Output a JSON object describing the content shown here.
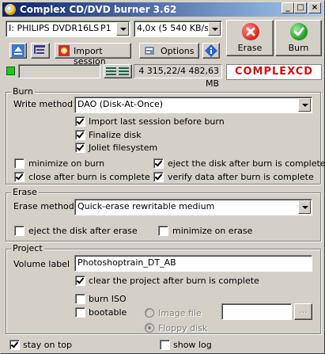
{
  "window": {
    "title": "Complex CD/DVD burner 3.62",
    "min": "_",
    "max": "□",
    "close": "×"
  },
  "toolbar": {
    "drive": "I: PHILIPS DVDR16LS",
    "drive_suffix": "P1",
    "speed": "4,0x (5 540 KB/s)",
    "import_session": "Import session",
    "options": "Options",
    "erase": "Erase",
    "burn": "Burn",
    "size": "4 315,22/4 482,63 MB",
    "logo": "COMPLEXCD"
  },
  "burn": {
    "title": "Burn",
    "write_method_label": "Write method",
    "write_method": "DAO (Disk-At-Once)",
    "import_last": "Import last session before burn",
    "finalize": "Finalize disk",
    "joliet": "Joliet filesystem",
    "minimize": "minimize on burn",
    "eject": "eject the disk after burn is complete",
    "close_after": "close after burn is complete",
    "verify": "verify data after burn is complete"
  },
  "erase": {
    "title": "Erase",
    "method_label": "Erase method",
    "method": "Quick-erase rewritable medium",
    "eject": "eject the disk after erase",
    "minimize": "minimize on erase"
  },
  "project": {
    "title": "Project",
    "volume_label": "Volume label",
    "volume_value": "Photoshoptrain_DT_AB",
    "clear_after": "clear the project after burn is complete",
    "burn_iso": "burn ISO",
    "bootable": "bootable",
    "image_file": "Image file",
    "floppy_disk": "Floppy disk",
    "browse": "..."
  },
  "footer": {
    "stay_on_top": "stay on top",
    "show_log": "show log"
  },
  "colors": {
    "title_start": "#0a246a",
    "title_end": "#a6caf0",
    "logo_red": "#d01010",
    "erase_red": "#e0302a",
    "burn_green": "#2aa52a"
  }
}
